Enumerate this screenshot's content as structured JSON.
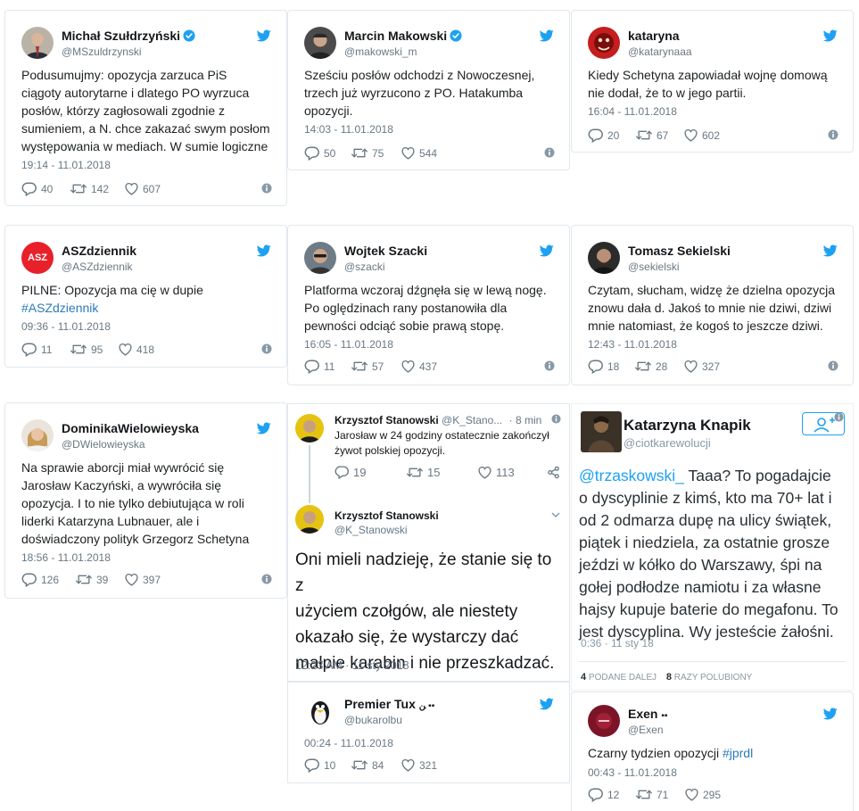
{
  "cards": {
    "c1": {
      "name": "Michał Szułdrzyński",
      "handle": "@MSzuldrzynski",
      "lines": [
        "Podusumujmy: opozycja zarzuca PiS",
        "ciągoty autorytarne i dlatego PO wyrzuca",
        "posłów, którzy zagłosowali zgodnie z",
        "sumieniem, a N. chce zakazać swym posłom",
        "występowania w mediach. W sumie logiczne"
      ],
      "date": "19:14 - 11.01.2018",
      "replies": "40",
      "retweets": "142",
      "likes": "607"
    },
    "c2": {
      "name": "Marcin Makowski",
      "handle": "@makowski_m",
      "lines": [
        "Sześciu posłów odchodzi z Nowoczesnej,",
        "trzech już wyrzucono z PO. Hatakumba",
        "opozycji."
      ],
      "date": "14:03 - 11.01.2018",
      "replies": "50",
      "retweets": "75",
      "likes": "544"
    },
    "c3": {
      "name": "kataryna",
      "handle": "@katarynaaa",
      "lines": [
        "Kiedy Schetyna zapowiadał wojnę domową",
        "nie dodał, że to w jego partii."
      ],
      "date": "16:04 - 11.01.2018",
      "replies": "20",
      "retweets": "67",
      "likes": "602"
    },
    "c4": {
      "name": "ASZdziennik",
      "handle": "@ASZdziennik",
      "avatar_text": "ASZ",
      "lines": [
        "PILNE: Opozycja ma cię w dupie"
      ],
      "hashtag": "#ASZdziennik",
      "date": "09:36 - 11.01.2018",
      "replies": "11",
      "retweets": "95",
      "likes": "418"
    },
    "c5": {
      "name": "Wojtek Szacki",
      "handle": "@szacki",
      "lines": [
        "Platforma wczoraj dźgnęła się w lewą nogę.",
        "Po oględzinach rany postanowiła dla",
        "pewności odciąć sobie prawą stopę."
      ],
      "date": "16:05 - 11.01.2018",
      "replies": "11",
      "retweets": "57",
      "likes": "437"
    },
    "c6": {
      "name": "Tomasz Sekielski",
      "handle": "@sekielski",
      "lines": [
        "Czytam, słucham, widzę że dzielna opozycja",
        "znowu dała d. Jakoś to mnie nie dziwi, dziwi",
        "mnie natomiast, że kogoś to jeszcze dziwi."
      ],
      "date": "12:43 - 11.01.2018",
      "replies": "18",
      "retweets": "28",
      "likes": "327"
    },
    "c7": {
      "name": "DominikaWielowieyska",
      "handle": "@DWielowieyska",
      "lines": [
        "Na sprawie aborcji miał wywrócić się",
        "Jarosław Kaczyński, a wywróciła się",
        "opozycja. I to nie tylko debiutująca w roli",
        "liderki Katarzyna Lubnauer, ale i",
        "doświadczony polityk Grzegorz Schetyna"
      ],
      "date": "18:56 - 11.01.2018",
      "replies": "126",
      "retweets": "39",
      "likes": "397"
    },
    "c8": {
      "name": "Premier Tux",
      "name_extra": "ﻦ ▪▪",
      "handle": "@bukarolbu",
      "date": "00:24 - 11.01.2018",
      "replies": "10",
      "retweets": "84",
      "likes": "321"
    },
    "c9": {
      "name": "Exen",
      "name_extra": "▪▪",
      "handle": "@Exen",
      "text": "Czarny tydzien opozycji ",
      "hashtag": "#jprdl",
      "date": "00:43 - 11.01.2018",
      "replies": "12",
      "retweets": "71",
      "likes": "295"
    }
  },
  "thread": {
    "top_name": "Krzysztof Stanowski",
    "top_handle": "@K_Stano...",
    "top_time": "· 8 min",
    "top_lines": [
      "Jarosław w 24 godziny ostatecznie zakończył",
      "żywot polskiej opozycji."
    ],
    "top_replies": "19",
    "top_retweets": "15",
    "top_likes": "113",
    "main_name": "Krzysztof Stanowski",
    "main_handle": "@K_Stanowski",
    "main_lines": [
      "Oni mieli nadzieję, że stanie się to z",
      "użyciem czołgów, ale niestety",
      "okazało się, że wystarczy dać",
      "małpie karabin i nie przeszkadzać."
    ],
    "main_date": "12:23 AM · 11 sty 2018"
  },
  "knapik": {
    "name": "Katarzyna Knapik",
    "handle": "@ciotkarewolucji",
    "mention": "@trzaskowski_",
    "lines": [
      " Taaa? To pogadajcie",
      "o dyscyplinie z kimś, kto ma 70+ lat i",
      "od 2 odmarza dupę na ulicy świątek,",
      "piątek i niedziela, za ostatnie grosze",
      "jeździ w kółko do Warszawy, śpi na",
      "gołej podłodze namiotu i za własne",
      "hajsy kupuje baterie do megafonu. To",
      "jest dyscyplina. Wy jesteście żałośni."
    ],
    "time": "0:36 · 11 sty 18",
    "rt_count": "4",
    "rt_label": "PODANE DALEJ",
    "like_count": "8",
    "like_label": "RAZY POLUBIONY"
  },
  "colors": {
    "twitter_blue": "#1da1f2",
    "gray": "#697882",
    "border": "#e1e8ed",
    "link": "#2b7bb9",
    "asz_red": "#e8202a"
  }
}
